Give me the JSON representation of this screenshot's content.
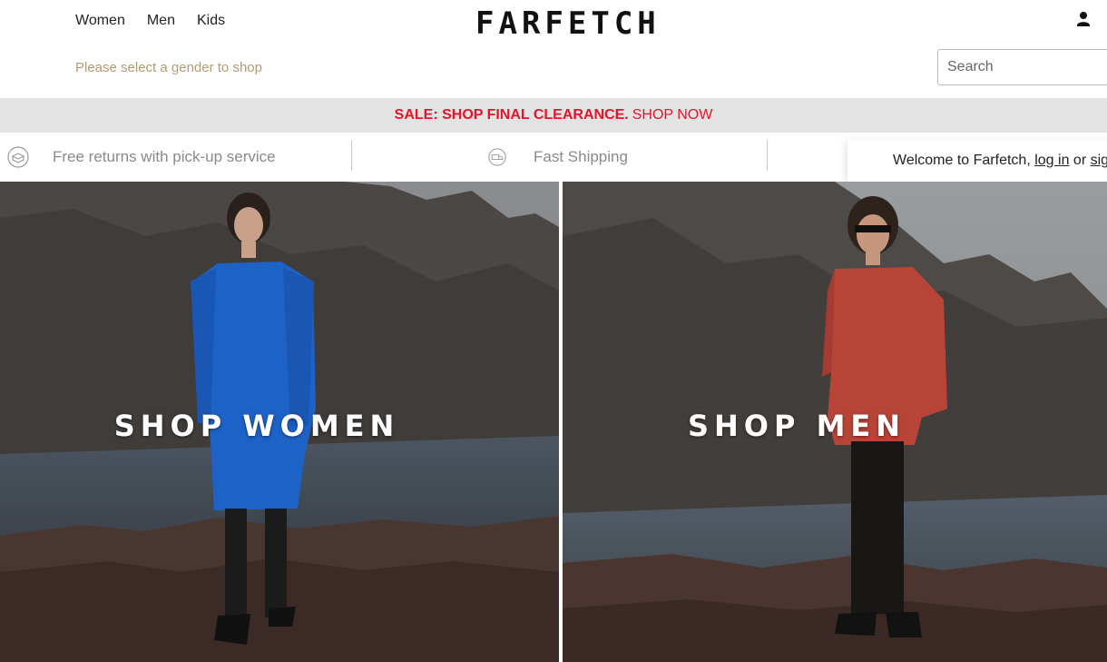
{
  "header": {
    "nav": [
      "Women",
      "Men",
      "Kids"
    ],
    "logo": "FARFETCH",
    "gender_hint": "Please select a gender to shop",
    "search_placeholder": "Search"
  },
  "sale_banner": {
    "headline": "SALE: SHOP FINAL CLEARANCE.",
    "cta": "SHOP NOW"
  },
  "services": {
    "returns": "Free returns with pick-up service",
    "shipping": "Fast Shipping"
  },
  "welcome": {
    "prefix": "Welcome to Farfetch,",
    "login": "log in",
    "or": "or",
    "signup": "sign up"
  },
  "panels": {
    "women": "SHOP WOMEN",
    "men": "SHOP MEN"
  },
  "colors": {
    "sale_red": "#e8132a",
    "hint_tan": "#b49b72",
    "banner_grey": "#e3e3e3"
  }
}
